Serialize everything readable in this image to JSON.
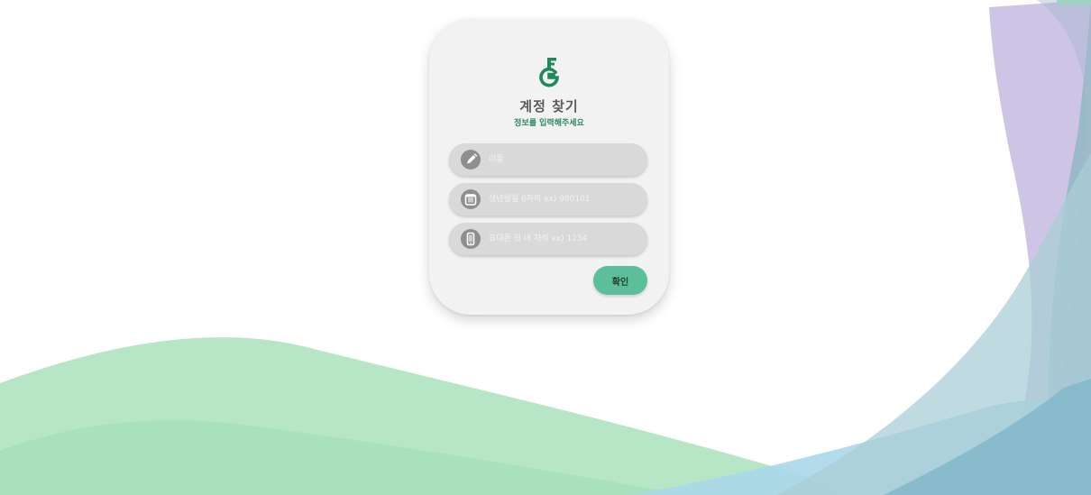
{
  "colors": {
    "accent": "#5cbe9b",
    "brand_green": "#1d8a5c",
    "card_bg": "#f2f2f2",
    "field_bg": "#d9d9d9",
    "icon_circle": "#8e8e8e"
  },
  "logo": {
    "icon": "key-logo-icon",
    "letters": "FG"
  },
  "header": {
    "title": "계정 찾기",
    "subtitle": "정보를 입력해주세요"
  },
  "form": {
    "fields": [
      {
        "icon": "pencil-icon",
        "placeholder": "이름",
        "value": ""
      },
      {
        "icon": "calendar-icon",
        "placeholder": "생년월일 6자리 ex) 990101",
        "value": ""
      },
      {
        "icon": "phone-icon",
        "placeholder": "휴대폰 뒷 네 자리 ex) 1234",
        "value": ""
      }
    ],
    "submit_label": "확인"
  }
}
